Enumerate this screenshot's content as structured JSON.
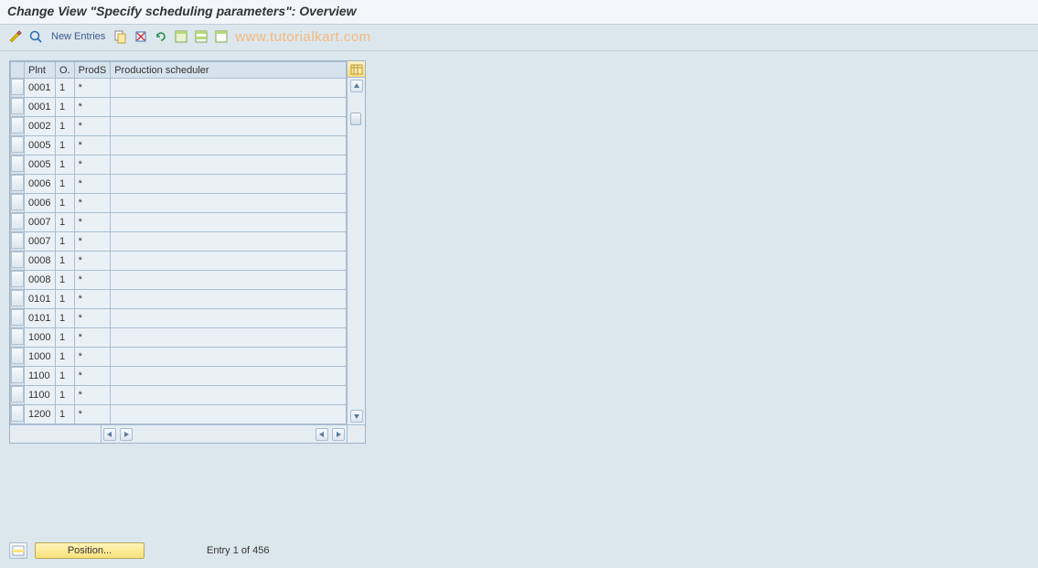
{
  "title": "Change View \"Specify scheduling parameters\": Overview",
  "toolbar": {
    "new_entries_label": "New Entries"
  },
  "watermark": "www.tutorialkart.com",
  "columns": {
    "plnt": "Plnt",
    "o": "O.",
    "prods": "ProdS",
    "sched": "Production scheduler"
  },
  "rows": [
    {
      "plnt": "0001",
      "o": "1",
      "prods": "*",
      "sched": ""
    },
    {
      "plnt": "0001",
      "o": "1",
      "prods": "*",
      "sched": ""
    },
    {
      "plnt": "0002",
      "o": "1",
      "prods": "*",
      "sched": ""
    },
    {
      "plnt": "0005",
      "o": "1",
      "prods": "*",
      "sched": ""
    },
    {
      "plnt": "0005",
      "o": "1",
      "prods": "*",
      "sched": ""
    },
    {
      "plnt": "0006",
      "o": "1",
      "prods": "*",
      "sched": ""
    },
    {
      "plnt": "0006",
      "o": "1",
      "prods": "*",
      "sched": ""
    },
    {
      "plnt": "0007",
      "o": "1",
      "prods": "*",
      "sched": ""
    },
    {
      "plnt": "0007",
      "o": "1",
      "prods": "*",
      "sched": ""
    },
    {
      "plnt": "0008",
      "o": "1",
      "prods": "*",
      "sched": ""
    },
    {
      "plnt": "0008",
      "o": "1",
      "prods": "*",
      "sched": ""
    },
    {
      "plnt": "0101",
      "o": "1",
      "prods": "*",
      "sched": ""
    },
    {
      "plnt": "0101",
      "o": "1",
      "prods": "*",
      "sched": ""
    },
    {
      "plnt": "1000",
      "o": "1",
      "prods": "*",
      "sched": ""
    },
    {
      "plnt": "1000",
      "o": "1",
      "prods": "*",
      "sched": ""
    },
    {
      "plnt": "1100",
      "o": "1",
      "prods": "*",
      "sched": ""
    },
    {
      "plnt": "1100",
      "o": "1",
      "prods": "*",
      "sched": ""
    },
    {
      "plnt": "1200",
      "o": "1",
      "prods": "*",
      "sched": ""
    }
  ],
  "footer": {
    "position_label": "Position...",
    "entry_info": "Entry 1 of 456"
  }
}
